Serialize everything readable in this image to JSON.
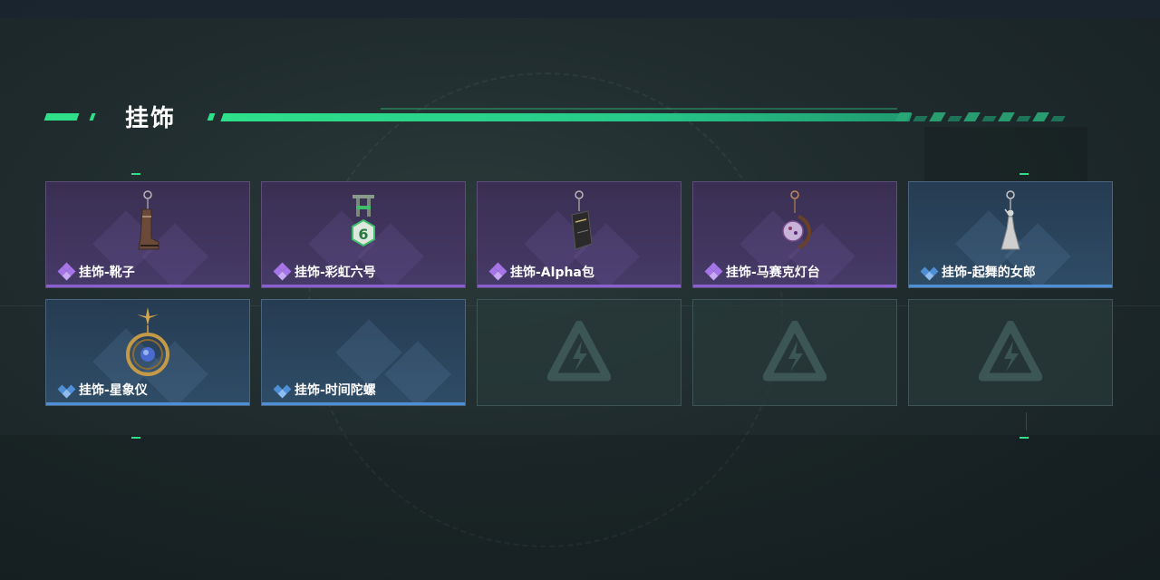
{
  "section_title": "挂饰",
  "colors": {
    "accent": "#2ee08a",
    "rarity_epic": "#8a5fd0",
    "rarity_rare": "#4f8fd6"
  },
  "items": [
    {
      "label": "挂饰-靴子",
      "rarity": "epic",
      "icon": "boot-charm-icon"
    },
    {
      "label": "挂饰-彩虹六号",
      "rarity": "epic",
      "icon": "rainbow-six-charm-icon"
    },
    {
      "label": "挂饰-Alpha包",
      "rarity": "epic",
      "icon": "alpha-bag-charm-icon"
    },
    {
      "label": "挂饰-马赛克灯台",
      "rarity": "epic",
      "icon": "mosaic-lamp-charm-icon"
    },
    {
      "label": "挂饰-起舞的女郎",
      "rarity": "rare",
      "icon": "dancing-lady-charm-icon"
    },
    {
      "label": "挂饰-星象仪",
      "rarity": "rare",
      "icon": "astrolabe-charm-icon"
    },
    {
      "label": "挂饰-时间陀螺",
      "rarity": "rare",
      "icon": "time-top-charm-icon"
    }
  ],
  "empty_slot_icon": "game-logo-icon"
}
